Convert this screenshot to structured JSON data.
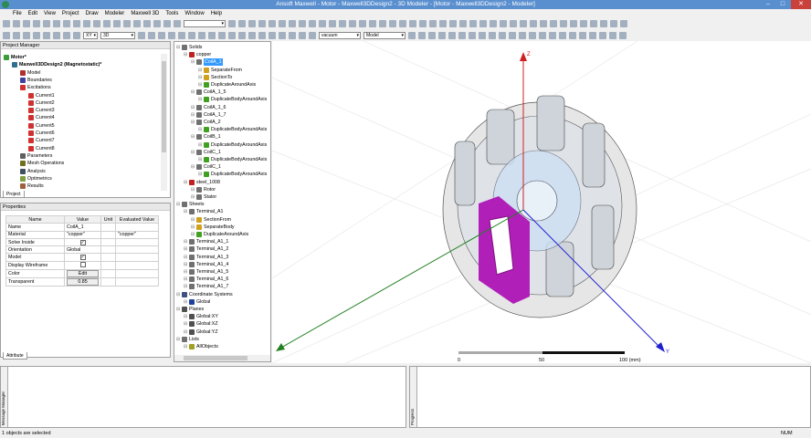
{
  "title": "Ansoft Maxwell  - Motor - Maxwell3DDesign2 - 3D Modeler - [Motor - Maxwell3DDesign2 - Modeler]",
  "menu": [
    "File",
    "Edit",
    "View",
    "Project",
    "Draw",
    "Modeler",
    "Maxwell 3D",
    "Tools",
    "Window",
    "Help"
  ],
  "toolbar": {
    "plane": "XY",
    "dimension": "3D",
    "material": "vacuum",
    "model": "Model"
  },
  "project_manager": {
    "title": "Project Manager",
    "tab": "Project",
    "items": [
      {
        "label": "Motor*",
        "level": 0,
        "icon": "project-icon",
        "color": "#3a9d3a",
        "bold": true
      },
      {
        "label": "Maxwell3DDesign2 (Magnetostatic)*",
        "level": 1,
        "icon": "design-icon",
        "color": "#2f6f8f",
        "bold": true
      },
      {
        "label": "Model",
        "level": 2,
        "icon": "model-icon",
        "color": "#b03030"
      },
      {
        "label": "Boundaries",
        "level": 2,
        "icon": "boundaries-icon",
        "color": "#4040a0"
      },
      {
        "label": "Excitations",
        "level": 2,
        "icon": "excitations-icon",
        "color": "#d03030"
      },
      {
        "label": "Current1",
        "level": 3,
        "icon": "current-icon",
        "color": "#d03030"
      },
      {
        "label": "Current2",
        "level": 3,
        "icon": "current-icon",
        "color": "#d03030"
      },
      {
        "label": "Current3",
        "level": 3,
        "icon": "current-icon",
        "color": "#d03030"
      },
      {
        "label": "Current4",
        "level": 3,
        "icon": "current-icon",
        "color": "#d03030"
      },
      {
        "label": "Current5",
        "level": 3,
        "icon": "current-icon",
        "color": "#d03030"
      },
      {
        "label": "Current6",
        "level": 3,
        "icon": "current-icon",
        "color": "#d03030"
      },
      {
        "label": "Current7",
        "level": 3,
        "icon": "current-icon",
        "color": "#d03030"
      },
      {
        "label": "Current8",
        "level": 3,
        "icon": "current-icon",
        "color": "#d03030"
      },
      {
        "label": "Parameters",
        "level": 2,
        "icon": "parameters-icon",
        "color": "#606060"
      },
      {
        "label": "Mesh Operations",
        "level": 2,
        "icon": "mesh-icon",
        "color": "#707020"
      },
      {
        "label": "Analysis",
        "level": 2,
        "icon": "analysis-icon",
        "color": "#405060"
      },
      {
        "label": "Optimetrics",
        "level": 2,
        "icon": "optimetrics-icon",
        "color": "#80a040"
      },
      {
        "label": "Results",
        "level": 2,
        "icon": "results-icon",
        "color": "#a06040"
      }
    ]
  },
  "properties": {
    "title": "Properties",
    "tab": "Attribute",
    "columns": [
      "Name",
      "Value",
      "Unit",
      "Evaluated Value"
    ],
    "rows": [
      {
        "name": "Name",
        "value": "CoilA_1",
        "unit": "",
        "evaluated": ""
      },
      {
        "name": "Material",
        "value": "\"copper\"",
        "unit": "",
        "evaluated": "\"copper\""
      },
      {
        "name": "Solve Inside",
        "check": true,
        "unit": "",
        "evaluated": ""
      },
      {
        "name": "Orientation",
        "value": "Global",
        "unit": "",
        "evaluated": ""
      },
      {
        "name": "Model",
        "check": true,
        "unit": "",
        "evaluated": ""
      },
      {
        "name": "Display Wireframe",
        "check": false,
        "unit": "",
        "evaluated": ""
      },
      {
        "name": "Color",
        "button": "Edit",
        "unit": "",
        "evaluated": ""
      },
      {
        "name": "Transparent",
        "button": "0.85",
        "unit": "",
        "evaluated": ""
      }
    ]
  },
  "model_tree": [
    {
      "label": "Solids",
      "level": 0,
      "color": "#707070"
    },
    {
      "label": "copper",
      "level": 1,
      "color": "#c02020"
    },
    {
      "label": "CoilA_1",
      "level": 2,
      "color": "#707070",
      "selected": true
    },
    {
      "label": "SeparateFrom",
      "level": 3,
      "color": "#d0a020"
    },
    {
      "label": "SectionTo",
      "level": 3,
      "color": "#d0a020"
    },
    {
      "label": "DuplicateAroundAxis",
      "level": 3,
      "color": "#40a020"
    },
    {
      "label": "CoilA_1_5",
      "level": 2,
      "color": "#707070"
    },
    {
      "label": "DuplicateBodyAroundAxis",
      "level": 3,
      "color": "#40a020"
    },
    {
      "label": "CoilA_1_6",
      "level": 2,
      "color": "#707070"
    },
    {
      "label": "CoilA_1_7",
      "level": 2,
      "color": "#707070"
    },
    {
      "label": "CoilA_2",
      "level": 2,
      "color": "#707070"
    },
    {
      "label": "DuplicateBodyAroundAxis",
      "level": 3,
      "color": "#40a020"
    },
    {
      "label": "CoilB_1",
      "level": 2,
      "color": "#707070"
    },
    {
      "label": "DuplicateBodyAroundAxis",
      "level": 3,
      "color": "#40a020"
    },
    {
      "label": "CoilC_1",
      "level": 2,
      "color": "#707070"
    },
    {
      "label": "DuplicateBodyAroundAxis",
      "level": 3,
      "color": "#40a020"
    },
    {
      "label": "CoilC_1",
      "level": 2,
      "color": "#707070"
    },
    {
      "label": "DuplicateBodyAroundAxis",
      "level": 3,
      "color": "#40a020"
    },
    {
      "label": "steel_1008",
      "level": 1,
      "color": "#c02020"
    },
    {
      "label": "Rotor",
      "level": 2,
      "color": "#707070"
    },
    {
      "label": "Stator",
      "level": 2,
      "color": "#707070"
    },
    {
      "label": "Sheets",
      "level": 0,
      "color": "#707070"
    },
    {
      "label": "Terminal_A1",
      "level": 1,
      "color": "#707070"
    },
    {
      "label": "SectionFrom",
      "level": 2,
      "color": "#d0a020"
    },
    {
      "label": "SeparateBody",
      "level": 2,
      "color": "#d0a020"
    },
    {
      "label": "DuplicateAroundAxis",
      "level": 2,
      "color": "#40a020"
    },
    {
      "label": "Terminal_A1_1",
      "level": 1,
      "color": "#707070"
    },
    {
      "label": "Terminal_A1_2",
      "level": 1,
      "color": "#707070"
    },
    {
      "label": "Terminal_A1_3",
      "level": 1,
      "color": "#707070"
    },
    {
      "label": "Terminal_A1_4",
      "level": 1,
      "color": "#707070"
    },
    {
      "label": "Terminal_A1_5",
      "level": 1,
      "color": "#707070"
    },
    {
      "label": "Terminal_A1_6",
      "level": 1,
      "color": "#707070"
    },
    {
      "label": "Terminal_A1_7",
      "level": 1,
      "color": "#707070"
    },
    {
      "label": "Coordinate Systems",
      "level": 0,
      "color": "#405080"
    },
    {
      "label": "Global",
      "level": 1,
      "color": "#2040a0"
    },
    {
      "label": "Planes",
      "level": 0,
      "color": "#505050"
    },
    {
      "label": "Global:XY",
      "level": 1,
      "color": "#505050"
    },
    {
      "label": "Global:XZ",
      "level": 1,
      "color": "#505050"
    },
    {
      "label": "Global:YZ",
      "level": 1,
      "color": "#505050"
    },
    {
      "label": "Lists",
      "level": 0,
      "color": "#707070"
    },
    {
      "label": "AllObjects",
      "level": 1,
      "color": "#a0a020"
    }
  ],
  "viewport": {
    "scale_labels": [
      "0",
      "50",
      "100 (mm)"
    ],
    "axes": {
      "z": "Z",
      "x": "X",
      "y": "Y"
    },
    "colors": {
      "z": "#d02020",
      "x": "#208020",
      "y": "#2020d0",
      "selected": "#c020c0"
    }
  },
  "message_manager": {
    "title": "Message Manager"
  },
  "progress": {
    "title": "Progress"
  },
  "status": {
    "text": "1 objects are selected",
    "num": "NUM"
  }
}
